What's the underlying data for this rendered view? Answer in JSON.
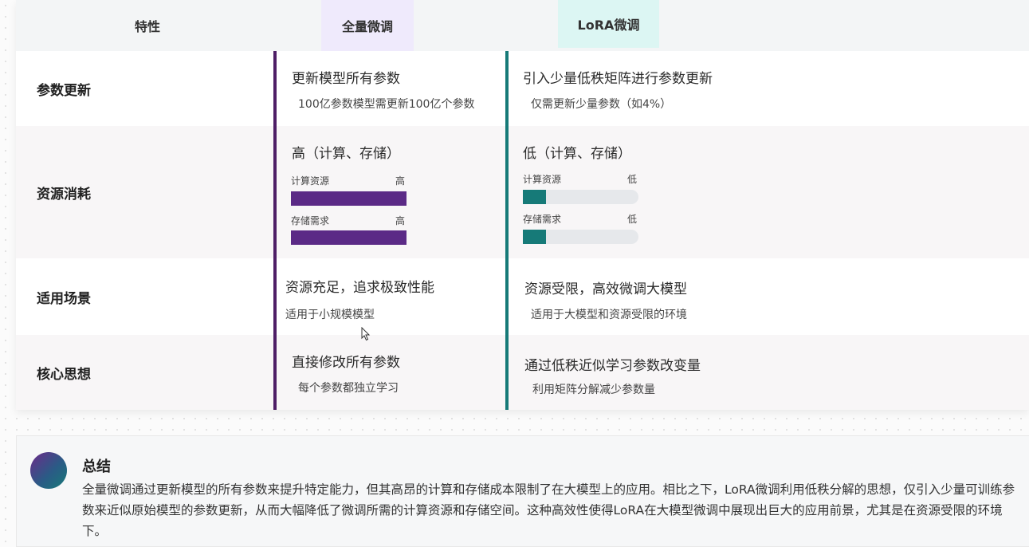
{
  "header": {
    "feature_label": "特性",
    "full_label": "全量微调",
    "lora_label": "LoRA微调"
  },
  "rows": [
    {
      "feature": "参数更新",
      "full": {
        "title": "更新模型所有参数",
        "sub": "100亿参数模型需更新100亿个参数"
      },
      "lora": {
        "title": "引入少量低秩矩阵进行参数更新",
        "sub": "仅需更新少量参数（如4%）"
      }
    },
    {
      "feature": "资源消耗",
      "full": {
        "title": "高（计算、存储）",
        "bars": [
          {
            "label": "计算资源",
            "level": "高",
            "fill_fraction": 1.0
          },
          {
            "label": "存储需求",
            "level": "高",
            "fill_fraction": 1.0
          }
        ]
      },
      "lora": {
        "title": "低（计算、存储）",
        "bars": [
          {
            "label": "计算资源",
            "level": "低",
            "fill_fraction": 0.2
          },
          {
            "label": "存储需求",
            "level": "低",
            "fill_fraction": 0.2
          }
        ]
      }
    },
    {
      "feature": "适用场景",
      "full": {
        "title": "资源充足，追求极致性能",
        "sub": "适用于小规模模型"
      },
      "lora": {
        "title": "资源受限，高效微调大模型",
        "sub": "适用于大模型和资源受限的环境"
      }
    },
    {
      "feature": "核心思想",
      "full": {
        "title": "直接修改所有参数",
        "sub": "每个参数都独立学习"
      },
      "lora": {
        "title": "通过低秩近似学习参数改变量",
        "sub": "利用矩阵分解减少参数量"
      }
    }
  ],
  "colors": {
    "full_accent": "#5b2a86",
    "lora_accent": "#167a78",
    "track": "#e6e8eb"
  },
  "summary": {
    "title": "总结",
    "body": "全量微调通过更新模型的所有参数来提升特定能力，但其高昂的计算和存储成本限制了在大模型上的应用。相比之下，LoRA微调利用低秩分解的思想，仅引入少量可训练参数来近似原始模型的参数更新，从而大幅降低了微调所需的计算资源和存储空间。这种高效性使得LoRA在大模型微调中展现出巨大的应用前景，尤其是在资源受限的环境下。"
  }
}
